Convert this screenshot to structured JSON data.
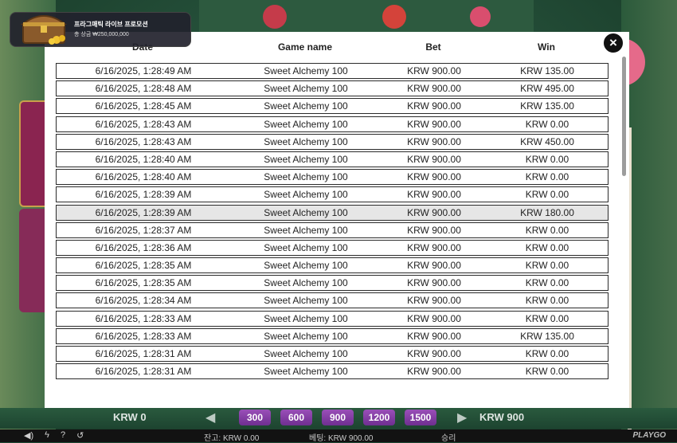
{
  "promo": {
    "title": "프라그매틱 라이브 프로모션",
    "prize": "총 상금 ₩250,000,000"
  },
  "history": {
    "headers": {
      "date": "Date",
      "game": "Game name",
      "bet": "Bet",
      "win": "Win"
    },
    "rows": [
      {
        "date": "6/16/2025, 1:28:49 AM",
        "game": "Sweet Alchemy 100",
        "bet": "KRW 900.00",
        "win": "KRW 135.00"
      },
      {
        "date": "6/16/2025, 1:28:48 AM",
        "game": "Sweet Alchemy 100",
        "bet": "KRW 900.00",
        "win": "KRW 495.00"
      },
      {
        "date": "6/16/2025, 1:28:45 AM",
        "game": "Sweet Alchemy 100",
        "bet": "KRW 900.00",
        "win": "KRW 135.00"
      },
      {
        "date": "6/16/2025, 1:28:43 AM",
        "game": "Sweet Alchemy 100",
        "bet": "KRW 900.00",
        "win": "KRW 0.00"
      },
      {
        "date": "6/16/2025, 1:28:43 AM",
        "game": "Sweet Alchemy 100",
        "bet": "KRW 900.00",
        "win": "KRW 450.00"
      },
      {
        "date": "6/16/2025, 1:28:40 AM",
        "game": "Sweet Alchemy 100",
        "bet": "KRW 900.00",
        "win": "KRW 0.00"
      },
      {
        "date": "6/16/2025, 1:28:40 AM",
        "game": "Sweet Alchemy 100",
        "bet": "KRW 900.00",
        "win": "KRW 0.00"
      },
      {
        "date": "6/16/2025, 1:28:39 AM",
        "game": "Sweet Alchemy 100",
        "bet": "KRW 900.00",
        "win": "KRW 0.00"
      },
      {
        "date": "6/16/2025, 1:28:39 AM",
        "game": "Sweet Alchemy 100",
        "bet": "KRW 900.00",
        "win": "KRW 180.00",
        "highlighted": true
      },
      {
        "date": "6/16/2025, 1:28:37 AM",
        "game": "Sweet Alchemy 100",
        "bet": "KRW 900.00",
        "win": "KRW 0.00"
      },
      {
        "date": "6/16/2025, 1:28:36 AM",
        "game": "Sweet Alchemy 100",
        "bet": "KRW 900.00",
        "win": "KRW 0.00"
      },
      {
        "date": "6/16/2025, 1:28:35 AM",
        "game": "Sweet Alchemy 100",
        "bet": "KRW 900.00",
        "win": "KRW 0.00"
      },
      {
        "date": "6/16/2025, 1:28:35 AM",
        "game": "Sweet Alchemy 100",
        "bet": "KRW 900.00",
        "win": "KRW 0.00"
      },
      {
        "date": "6/16/2025, 1:28:34 AM",
        "game": "Sweet Alchemy 100",
        "bet": "KRW 900.00",
        "win": "KRW 0.00"
      },
      {
        "date": "6/16/2025, 1:28:33 AM",
        "game": "Sweet Alchemy 100",
        "bet": "KRW 900.00",
        "win": "KRW 0.00"
      },
      {
        "date": "6/16/2025, 1:28:33 AM",
        "game": "Sweet Alchemy 100",
        "bet": "KRW 900.00",
        "win": "KRW 135.00"
      },
      {
        "date": "6/16/2025, 1:28:31 AM",
        "game": "Sweet Alchemy 100",
        "bet": "KRW 900.00",
        "win": "KRW 0.00"
      },
      {
        "date": "6/16/2025, 1:28:31 AM",
        "game": "Sweet Alchemy 100",
        "bet": "KRW 900.00",
        "win": "KRW 0.00"
      }
    ]
  },
  "close_icon": "×",
  "game_bar": {
    "left_amount": "KRW 0",
    "right_amount": "KRW 900",
    "chips": [
      "300",
      "600",
      "900",
      "1200",
      "1500"
    ]
  },
  "status_bar": {
    "icons": [
      "speaker-icon",
      "lightning-icon",
      "question-icon",
      "history-icon"
    ],
    "balance": "잔고: KRW 0.00",
    "bet": "베팅: KRW 900.00",
    "win": "승리",
    "logo": "PLAYGO"
  }
}
